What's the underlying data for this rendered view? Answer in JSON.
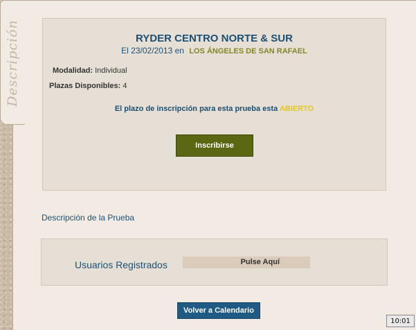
{
  "sidebar": {
    "tab_label": "Descripción"
  },
  "event": {
    "title": "RYDER CENTRO NORTE & SUR",
    "date_prefix": "El",
    "date": "23/02/2013 en",
    "place": "LOS ÁNGELES DE SAN RAFAEL",
    "modalidad_label": "Modalidad:",
    "modalidad_value": "Individual",
    "plazas_label": "Plazas Disponibles:",
    "plazas_value": "4",
    "status_text": "El plazo de inscripción para esta prueba esta",
    "status_value": "ABIERTO",
    "inscribirse_label": "Inscribirse"
  },
  "description": {
    "heading": "Descripción de la Prueba"
  },
  "users": {
    "label": "Usuarios Registrados",
    "pulse_label": "Pulse Aquí"
  },
  "footer": {
    "back_label": "Volver a Calendario"
  },
  "clock": {
    "time": "10:01"
  },
  "colors": {
    "title": "#1c4f73",
    "place": "#848628",
    "status_open": "#e5c619",
    "inscribirse_bg": "#5b6711",
    "volver_bg": "#1e5a84"
  }
}
